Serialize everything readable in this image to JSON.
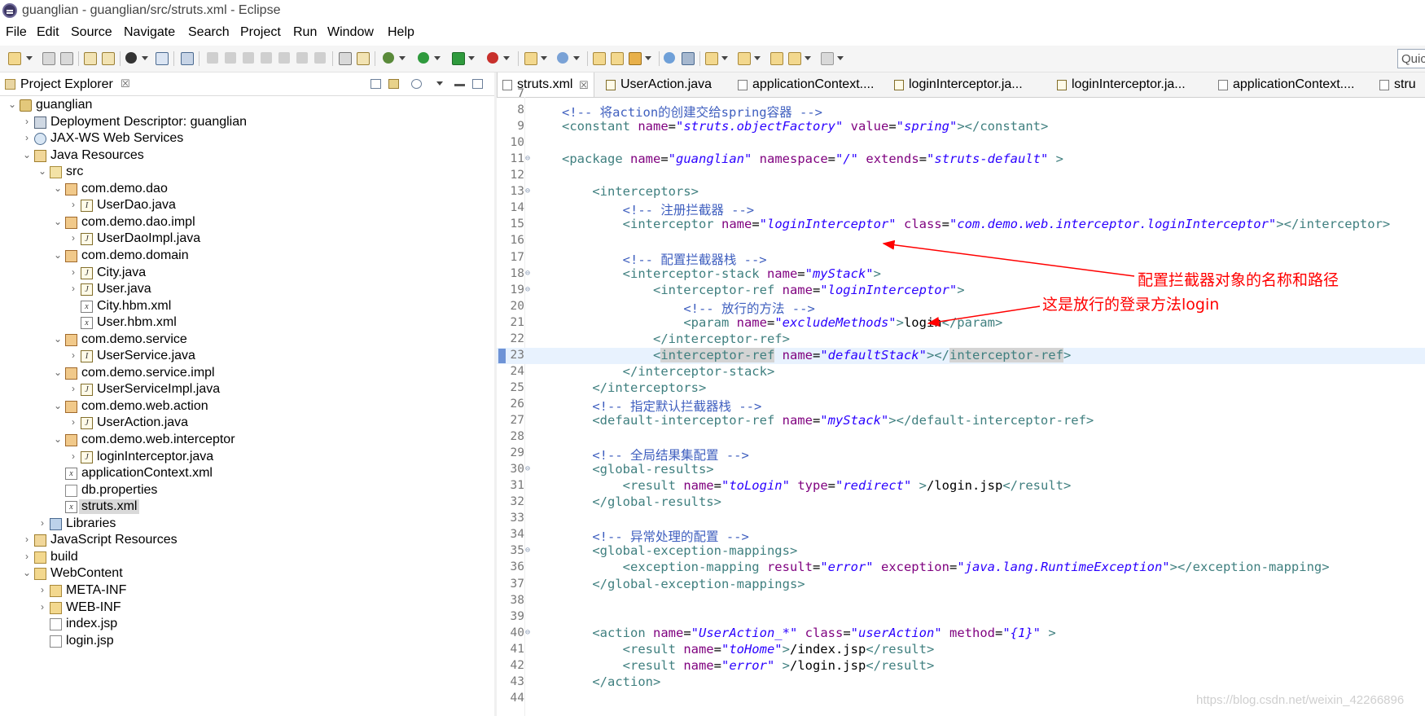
{
  "window": {
    "title": "guanglian - guanglian/src/struts.xml - Eclipse"
  },
  "menu": [
    "File",
    "Edit",
    "Source",
    "Navigate",
    "Search",
    "Project",
    "Run",
    "Window",
    "Help"
  ],
  "toolbar": {
    "quick_access": "Quick Access"
  },
  "explorer": {
    "title": "Project Explorer",
    "close": "☒",
    "items": [
      {
        "label": "guanglian",
        "icon": "project-icon"
      },
      {
        "label": "Deployment Descriptor: guanglian",
        "icon": "deployment-descriptor-icon"
      },
      {
        "label": "JAX-WS Web Services",
        "icon": "web-services-icon"
      },
      {
        "label": "Java Resources",
        "icon": "java-resources-icon"
      },
      {
        "label": "src",
        "icon": "source-folder-icon"
      },
      {
        "label": "com.demo.dao",
        "icon": "package-icon"
      },
      {
        "label": "UserDao.java",
        "icon": "java-interface-icon"
      },
      {
        "label": "com.demo.dao.impl",
        "icon": "package-icon"
      },
      {
        "label": "UserDaoImpl.java",
        "icon": "java-file-icon"
      },
      {
        "label": "com.demo.domain",
        "icon": "package-icon"
      },
      {
        "label": "City.java",
        "icon": "java-file-icon"
      },
      {
        "label": "User.java",
        "icon": "java-file-icon"
      },
      {
        "label": "City.hbm.xml",
        "icon": "xml-file-icon"
      },
      {
        "label": "User.hbm.xml",
        "icon": "xml-file-icon"
      },
      {
        "label": "com.demo.service",
        "icon": "package-icon"
      },
      {
        "label": "UserService.java",
        "icon": "java-interface-icon"
      },
      {
        "label": "com.demo.service.impl",
        "icon": "package-icon"
      },
      {
        "label": "UserServiceImpl.java",
        "icon": "java-file-icon"
      },
      {
        "label": "com.demo.web.action",
        "icon": "package-icon"
      },
      {
        "label": "UserAction.java",
        "icon": "java-file-icon"
      },
      {
        "label": "com.demo.web.interceptor",
        "icon": "package-icon"
      },
      {
        "label": "loginInterceptor.java",
        "icon": "java-file-icon"
      },
      {
        "label": "applicationContext.xml",
        "icon": "xml-file-icon"
      },
      {
        "label": "db.properties",
        "icon": "properties-file-icon"
      },
      {
        "label": "struts.xml",
        "icon": "xml-file-icon"
      },
      {
        "label": "Libraries",
        "icon": "libraries-icon"
      },
      {
        "label": "JavaScript Resources",
        "icon": "javascript-resources-icon"
      },
      {
        "label": "build",
        "icon": "folder-icon"
      },
      {
        "label": "WebContent",
        "icon": "folder-icon"
      },
      {
        "label": "META-INF",
        "icon": "folder-icon"
      },
      {
        "label": "WEB-INF",
        "icon": "folder-icon"
      },
      {
        "label": "index.jsp",
        "icon": "jsp-file-icon"
      },
      {
        "label": "login.jsp",
        "icon": "jsp-file-icon"
      }
    ]
  },
  "editor": {
    "tabs": [
      {
        "label": "struts.xml",
        "close": "☒"
      },
      {
        "label": "UserAction.java"
      },
      {
        "label": "applicationContext...."
      },
      {
        "label": "loginInterceptor.ja..."
      },
      {
        "label": "loginInterceptor.ja..."
      },
      {
        "label": "applicationContext...."
      },
      {
        "label": "stru"
      }
    ],
    "line_numbers": [
      "7",
      "8",
      "9",
      "10",
      "11",
      "12",
      "13",
      "14",
      "15",
      "16",
      "17",
      "18",
      "19",
      "20",
      "21",
      "22",
      "23",
      "24",
      "25",
      "26",
      "27",
      "28",
      "29",
      "30",
      "31",
      "32",
      "33",
      "34",
      "35",
      "36",
      "37",
      "38",
      "39",
      "40",
      "41",
      "42",
      "43",
      "44"
    ],
    "annotations": {
      "interceptor_note": "配置拦截器对象的名称和路径",
      "login_note": "这是放行的登录方法login"
    }
  },
  "watermark": "https://blog.csdn.net/weixin_42266896",
  "colors": {
    "tag": "#3f7f7f",
    "attribute": "#7f007f",
    "value": "#2a00ff",
    "comment": "#3f5fbf",
    "annotation": "#ff0000"
  }
}
